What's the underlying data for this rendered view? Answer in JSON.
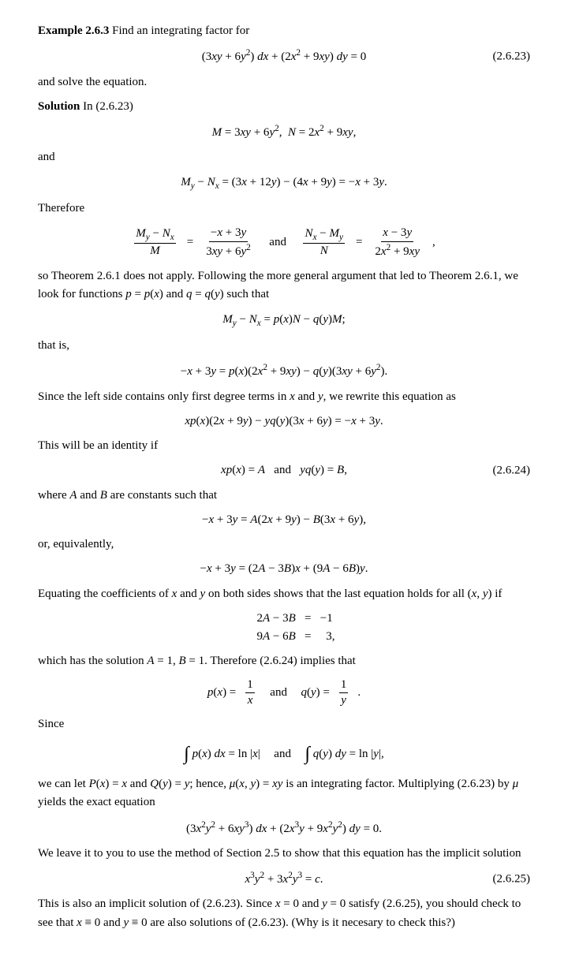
{
  "title": "Example 2.6.3",
  "content": {
    "example_label": "Example 2.6.3",
    "intro": "Find an integrating factor for",
    "eq_2623_label": "(2.6.23)",
    "eq_2623": "(3xy + 6y²) dx + (2x² + 9xy) dy = 0",
    "and_solve": "and solve the equation.",
    "solution_label": "Solution",
    "in_ref": "In (2.6.23)",
    "M_N_def": "M = 3xy + 6y², N = 2x² + 9xy,",
    "and": "and",
    "My_Nx": "My − Nx = (3x + 12y) − (4x + 9y) = −x + 3y.",
    "therefore": "Therefore",
    "frac_left_num": "My − Nx",
    "frac_left_den": "M",
    "frac_left_val": "−x + 3y",
    "frac_left_den2": "3xy + 6y²",
    "frac_right_num": "Nx − My",
    "frac_right_den": "N",
    "frac_right_val": "x − 3y",
    "frac_right_den2": "2x² + 9xy",
    "theorem_text": "so Theorem 2.6.1 does not apply. Following the more general argument that led to Theorem 2.6.1, we look for functions p = p(x) and q = q(y) such that",
    "pq_eq": "My − Nx = p(x)N − q(y)M;",
    "that_is": "that is,",
    "expand_eq": "−x + 3y = p(x)(2x² + 9xy) − q(y)(3xy + 6y²).",
    "since_text": "Since the left side contains only first degree terms in x and y, we rewrite this equation as",
    "rewrite_eq": "xp(x)(2x + 9y) − yq(y)(3x + 6y) = −x + 3y.",
    "identity_text": "This will be an identity if",
    "identity_eq": "xp(x) = A   and   yq(y) = B,",
    "eq_2624_label": "(2.6.24)",
    "where_text": "where A and B are constants such that",
    "AB_eq": "−x + 3y = A(2x + 9y) − B(3x + 6y),",
    "or_equiv": "or, equivalently,",
    "equiv_eq": "−x + 3y = (2A − 3B)x + (9A − 6B)y.",
    "equating_text": "Equating the coefficients of x and y on both sides shows that the last equation holds for all (x, y) if",
    "system_row1": "2A − 3B   =   −1",
    "system_row2": "9A − 6B   =   3,",
    "solution_text": "which has the solution A = 1, B = 1. Therefore (2.6.24) implies that",
    "pq_solution": "p(x) =",
    "frac_1_x_num": "1",
    "frac_1_x_den": "x",
    "and_word": "and",
    "qy_solution": "q(y) =",
    "frac_1_y_num": "1",
    "frac_1_y_den": "y",
    "since2": "Since",
    "integral_px": "∫ p(x) dx = ln|x|",
    "and2": "and",
    "integral_qy": "∫ q(y) dy = ln|y|,",
    "we_can": "we can let P(x) = x and Q(y) = y; hence, μ(x, y) = xy is an integrating factor. Multiplying (2.6.23) by μ yields the exact equation",
    "exact_eq": "(3x²y² + 6xy³) dx + (2x³y + 9x²y²) dy = 0.",
    "leave_text": "We leave it to you to use the method of Section 2.5 to show that this equation has the implicit solution",
    "implicit_sol": "x³y² + 3x²y³ = c.",
    "eq_2625_label": "(2.6.25)",
    "final_text": "This is also an implicit solution of (2.6.23). Since x = 0 and y = 0 satisfy (2.6.25), you should check to see that x ≡ 0 and y ≡ 0 are also solutions of (2.6.23). (Why is it necesary to check this?)"
  }
}
